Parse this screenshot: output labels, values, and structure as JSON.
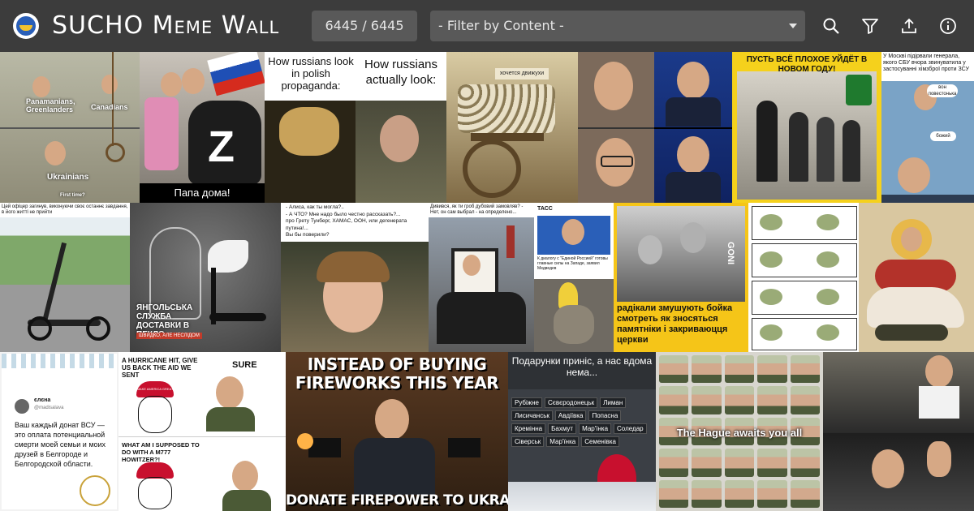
{
  "header": {
    "title": "SUCHO Meme Wall",
    "counter": "6445 / 6445",
    "filter_placeholder": "- Filter by Content -",
    "icons": [
      "search-icon",
      "filter-icon",
      "upload-icon",
      "info-icon"
    ]
  },
  "tiles": {
    "t1": {
      "label1": "Panamanians,\nGreenlanders",
      "label2": "Canadians",
      "label3": "Ukrainians",
      "label4": "First time?"
    },
    "t2": {
      "caption": "Папа дома!",
      "badge": "Z"
    },
    "t3": {
      "left": "How russians look in polish propaganda:",
      "right": "How russians actually look:"
    },
    "t4": {
      "caption": "хочется движухи"
    },
    "t7": {
      "caption": "ПУСТЬ ВСЁ ПЛОХОЕ УЙДЁТ В НОВОМ ГОДУ!"
    },
    "t8": {
      "caption": "У Москві підірвали генерала, якого СБУ вчора звинуватила у застосуванні хімзброї проти ЗСУ",
      "b1": "вон повестонька",
      "b2": "божий"
    },
    "t9": {
      "caption": "Цей офіцер загинув, виконуючи своє останнє завдання, в його житті не прийти"
    },
    "t10": {
      "caption": "ЯНГОЛЬСЬКА СЛУЖБА ДОСТАВКИ В ПЕКЛО",
      "sub": "ШВИДКО, АЛЕ НЕСЛІДОМ"
    },
    "t11": {
      "text": "- Алиса, как ты могла?..\n- А ЧТО? Мне надо было честно рассказать?...\nпро Грету Тунберг, ХАМАС, ООН, или дегенерата путина!...\nВы бы поверили?"
    },
    "t12": {
      "caption": "Дивився, як ти гроб дубовий замовляв? - Нет, он сам выбрал - на определено..."
    },
    "t13": {
      "agency": "ТАСС",
      "caption": "К диалогу с \"Единой Россией\" готовы главные силы на Западе, заявил Медведев"
    },
    "t14": {
      "caption": "радікали змушують бойка смотреть як зносяться памятніки і закриваюцця церкви",
      "logo": "GONI"
    },
    "t17": {
      "handle": "@madisalava",
      "name": "єлєна",
      "text": "Ваш каждый донат ВСУ — это оплата потенциальной смерти моей семьи и моих друзей в Белгороде и Белгородской области."
    },
    "t18": {
      "q1": "A HURRICANE HIT, GIVE US BACK THE AID WE SENT",
      "a1": "SURE",
      "q2": "WHAT AM I SUPPOSED TO DO WITH A M777 HOWITZER?!",
      "hat": "MAKE AMERICA GREAT AGAIN"
    },
    "t19": {
      "top": "INSTEAD OF BUYING FIREWORKS THIS YEAR",
      "bottom": "DONATE FIREPOWER TO UKRAINE"
    },
    "t20": {
      "top": "Подарунки приніс, а нас вдома нема...",
      "cities": [
        "Рубіжне",
        "Сєвєродонецьк",
        "Лиман",
        "Лисичанськ",
        "Авдіївка",
        "Попасна",
        "Кремінна",
        "Бахмут",
        "Мар'їнка",
        "Соледар",
        "Сіверськ",
        "Мар'їнка",
        "Семенівка"
      ]
    },
    "t21": {
      "caption": "The Hague awaits you all"
    }
  }
}
